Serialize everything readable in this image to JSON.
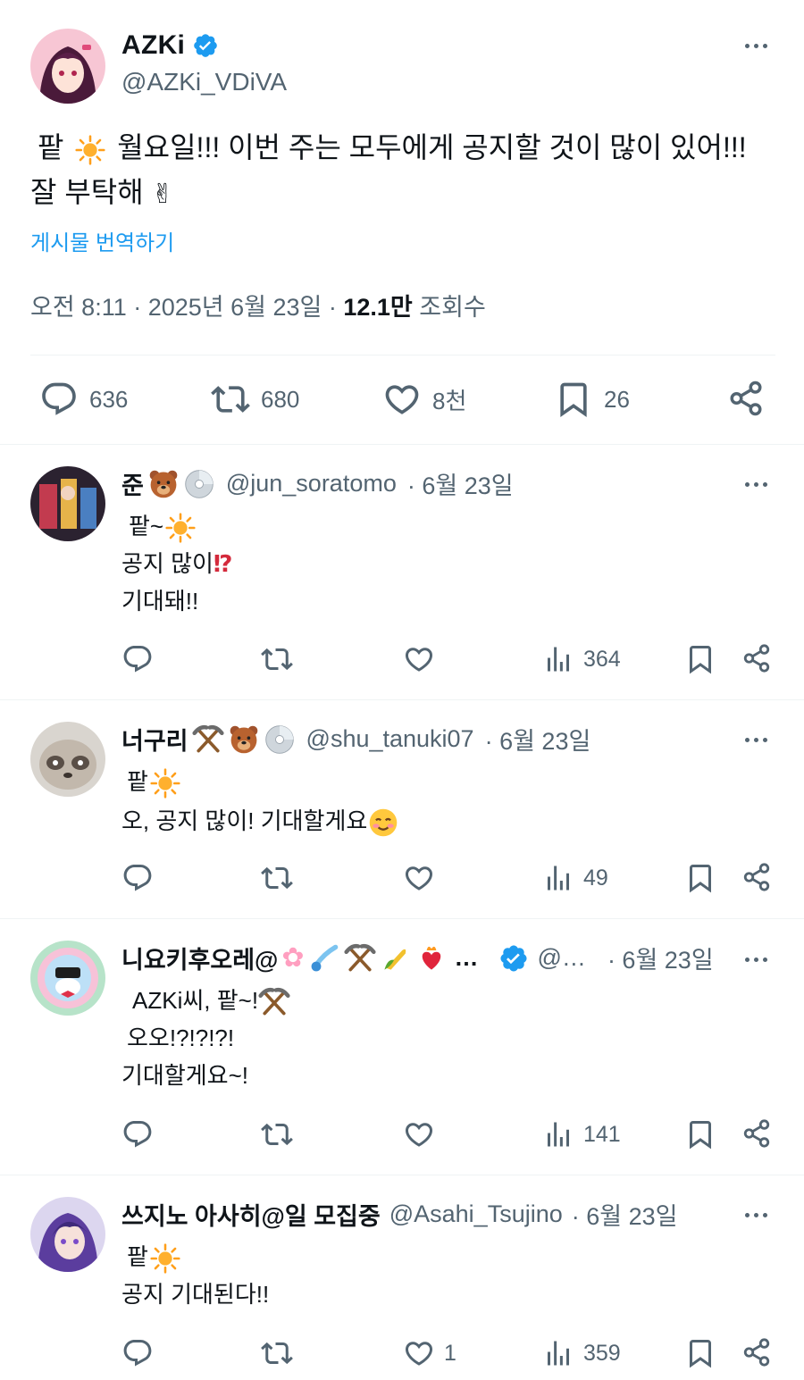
{
  "tweet": {
    "name": "AZKi",
    "handle": "@AZKi_VDiVA",
    "text_line1_a": "팥",
    "text_line1_b": "월요일!!! 이번 주는 모두에게 공지할 것이 많이 있어!!!",
    "text_line2": "잘 부탁해",
    "translate_label": "게시물 번역하기",
    "time": "오전 8:11 · 2025년 6월 23일 ·",
    "views_count": "12.1만",
    "views_label": "조회수",
    "stats": {
      "replies": "636",
      "retweets": "680",
      "likes": "8천",
      "bookmarks": "26"
    }
  },
  "replies": [
    {
      "name": "준",
      "handle": "@jun_soratomo",
      "date": "· 6월 23일",
      "lines": [
        "팥~",
        "공지 많이",
        "기대돼!!"
      ],
      "likes": "",
      "views": "364"
    },
    {
      "name": "너구리",
      "handle": "@shu_tanuki07",
      "date": "· 6월 23일",
      "lines": [
        "팥",
        "오, 공지 많이! 기대할게요"
      ],
      "likes": "",
      "views": "49"
    },
    {
      "name": "니요키후오레@",
      "name_tail": "…",
      "handle": "@…",
      "date": "· 6월 23일",
      "lines": [
        "AZKi씨, 팥~!",
        "오오!?!?!?!",
        "기대할게요~!"
      ],
      "likes": "",
      "views": "141"
    },
    {
      "name": "쓰지노 아사히@일 모집중",
      "handle": "@Asahi_Tsujino",
      "date": "· 6월 23일",
      "lines": [
        "팥",
        "공지 기대된다!!"
      ],
      "likes": "1",
      "views": "359"
    }
  ],
  "colors": {
    "accent": "#1d9bf0",
    "text": "#0f1419",
    "muted": "#536471",
    "divider": "#eff3f4"
  }
}
